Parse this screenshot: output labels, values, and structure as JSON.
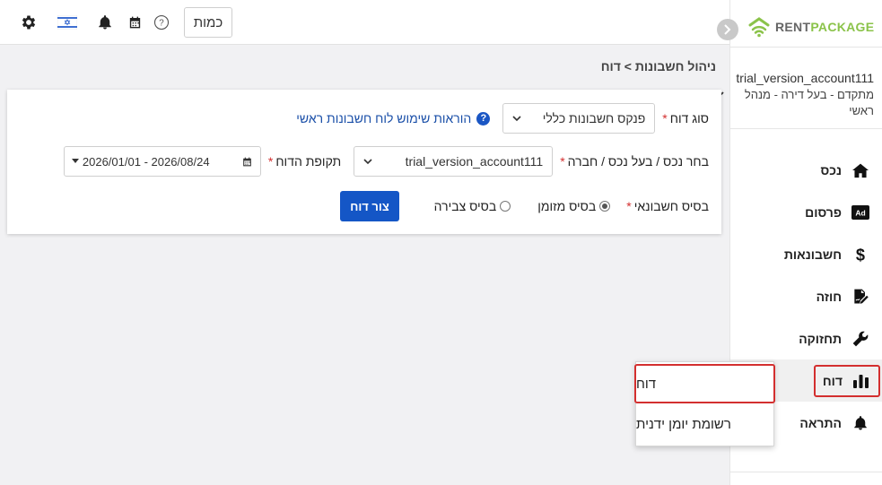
{
  "topbar": {
    "units_label": "כמות",
    "icons": [
      "settings-icon",
      "israel-flag-icon",
      "bell-icon",
      "calendar-icon",
      "help-icon"
    ]
  },
  "brand": {
    "rent": "RENT",
    "package": "PACKAGE"
  },
  "account": {
    "name": "trial_version_account111",
    "role": "מתקדם - בעל דירה - מנהל ראשי"
  },
  "sidebar": {
    "items": [
      {
        "label": "נכס",
        "icon": "home-icon"
      },
      {
        "label": "פרסום",
        "icon": "ad-icon"
      },
      {
        "label": "חשבונאות",
        "icon": "dollar-icon"
      },
      {
        "label": "חוזה",
        "icon": "contract-icon"
      },
      {
        "label": "תחזוקה",
        "icon": "wrench-icon"
      },
      {
        "label": "דוח",
        "icon": "bar-chart-icon"
      },
      {
        "label": "התראה",
        "icon": "bell-icon"
      }
    ]
  },
  "breadcrumb": "ניהול חשבונות > דוח",
  "form": {
    "report_type_label": "סוג דוח",
    "report_type_value": "פנקס חשבונות כללי",
    "help_link": "הוראות שימוש לוח חשבונות ראשי",
    "help_mark": "?",
    "property_label": "בחר נכס / בעל נכס / חברה",
    "property_value": "trial_version_account111",
    "period_label": "תקופת הדוח",
    "period_value": "2026/01/01 - 2026/08/24",
    "basis_label": "בסיס חשבונאי",
    "basis_options": [
      {
        "label": "בסיס מזומן",
        "selected": true
      },
      {
        "label": "בסיס צבירה",
        "selected": false
      }
    ],
    "submit_label": "צור דוח",
    "required_mark": "*"
  },
  "dropdown": {
    "items": [
      "דוח",
      "רשומת יומן ידנית"
    ]
  },
  "colors": {
    "accent": "#1456c6",
    "highlight": "#d32f2f",
    "brand_green": "#8bc34a"
  }
}
